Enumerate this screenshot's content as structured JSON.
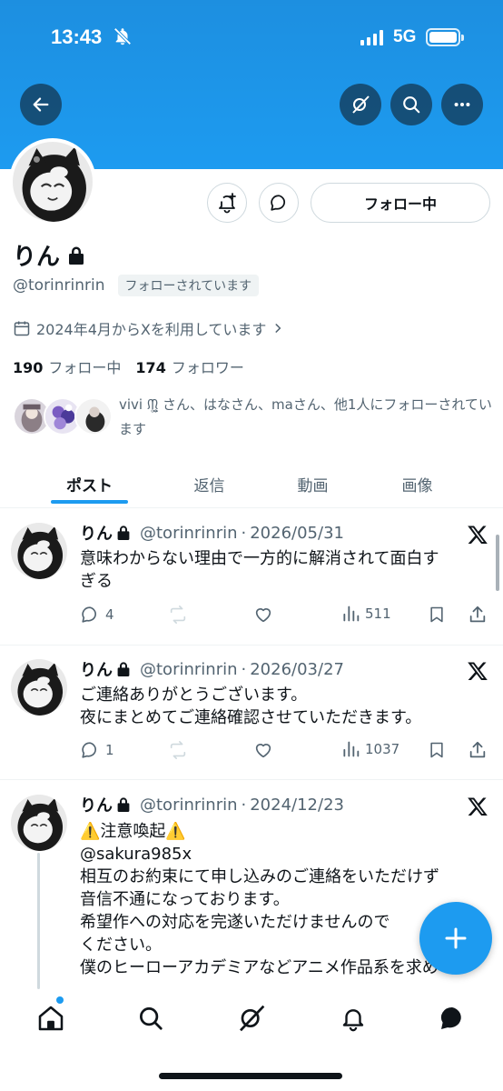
{
  "status_bar": {
    "time": "13:43",
    "network": "5G"
  },
  "header": {
    "back_icon": "arrow-left-icon",
    "grok_icon": "grok-icon",
    "search_icon": "search-icon",
    "more_icon": "more-horizontal-icon"
  },
  "profile": {
    "name": "りん",
    "handle": "@torinrinrin",
    "follows_you": "フォローされています",
    "joined": "2024年4月からXを利用しています",
    "following_count": "190",
    "following_label": "フォロー中",
    "followers_count": "174",
    "followers_label": "フォロワー",
    "followed_by": "vivi ᙏ̤̫͚ さん、はなさん、maさん、他1人にフォローされています",
    "follow_button": "フォロー中"
  },
  "tabs": [
    "ポスト",
    "返信",
    "動画",
    "画像"
  ],
  "tweets": [
    {
      "name": "りん",
      "handle": "@torinrinrin",
      "date": "2026/05/31",
      "lines": [
        "意味わからない理由で一方的に解消されて面白す",
        "ぎる"
      ],
      "replies": "4",
      "views": "511"
    },
    {
      "name": "りん",
      "handle": "@torinrinrin",
      "date": "2026/03/27",
      "lines": [
        "ご連絡ありがとうございます。",
        "夜にまとめてご連絡確認させていただきます。"
      ],
      "replies": "1",
      "views": "1037"
    },
    {
      "name": "りん",
      "handle": "@torinrinrin",
      "date": "2024/12/23",
      "lines": [
        "⚠️注意喚起⚠️",
        "@sakura985x",
        "相互のお約束にて申し込みのご連絡をいただけず",
        "音信不通になっております。",
        "希望作への対応を完遂いただけませんので",
        "ください。",
        "僕のヒーローアカデミアなどアニメ作品系を求め"
      ]
    }
  ],
  "separator": "·",
  "colors": {
    "accent": "#1d9bf0",
    "text": "#0f1419",
    "muted": "#536471"
  }
}
